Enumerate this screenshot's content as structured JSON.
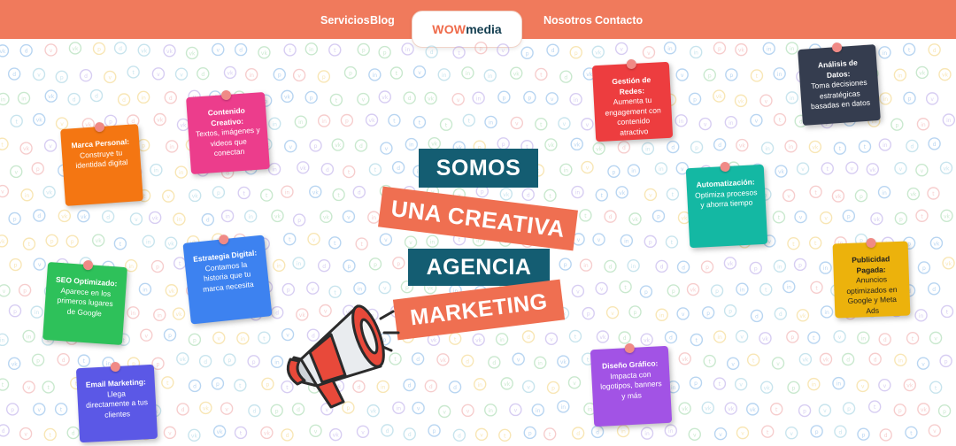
{
  "nav": {
    "links_left": [
      "Servicios",
      "Blog"
    ],
    "links_right": [
      "Nosotros",
      "Contacto"
    ],
    "logo": {
      "part1": "WOW",
      "part2": "media"
    }
  },
  "hero": {
    "lines": [
      "SOMOS",
      "UNA CREATIVA",
      "AGENCIA",
      "MARKETING"
    ]
  },
  "notes": [
    {
      "title": "Marca Personal:",
      "body": "Construye tu identidad digital",
      "color": "#f47612"
    },
    {
      "title": "Contenido Creativo:",
      "body": "Textos, imágenes y videos que conectan",
      "color": "#ec3d8c"
    },
    {
      "title": "Estrategia Digital:",
      "body": "Contamos la historia que tu marca necesita",
      "color": "#3d82f0"
    },
    {
      "title": "SEO Optimizado:",
      "body": "Aparece en los primeros lugares de Google",
      "color": "#2ec15a"
    },
    {
      "title": "Email Marketing:",
      "body": "Llega directamente a tus clientes",
      "color": "#5b58e6"
    },
    {
      "title": "Gestión de Redes:",
      "body": "Aumenta tu engagement con contenido atractivo",
      "color": "#ed3d3f"
    },
    {
      "title": "Automatización:",
      "body": "Optimiza procesos y ahorra tiempo",
      "color": "#14b8a3"
    },
    {
      "title": "Diseño Gráfico:",
      "body": "Impacta con logotipos, banners y más",
      "color": "#a253e5"
    },
    {
      "title": "Análisis de Datos:",
      "body": "Toma decisiones estratégicas basadas en datos",
      "color": "#353d4f"
    },
    {
      "title": "Publicidad Pagada:",
      "body": "Anuncios optimizados en Google y Meta Ads",
      "color": "#ecb20c"
    }
  ],
  "colors": {
    "header": "#f07a5c",
    "accent": "#ef6f51",
    "teal": "#145d72",
    "pin": "#f08a86"
  },
  "icons": [
    "linkedin-icon",
    "vk-icon",
    "pinterest-icon",
    "dropbox-icon",
    "instagram-icon",
    "vine-icon",
    "tumblr-icon",
    "megaphone-icon"
  ]
}
